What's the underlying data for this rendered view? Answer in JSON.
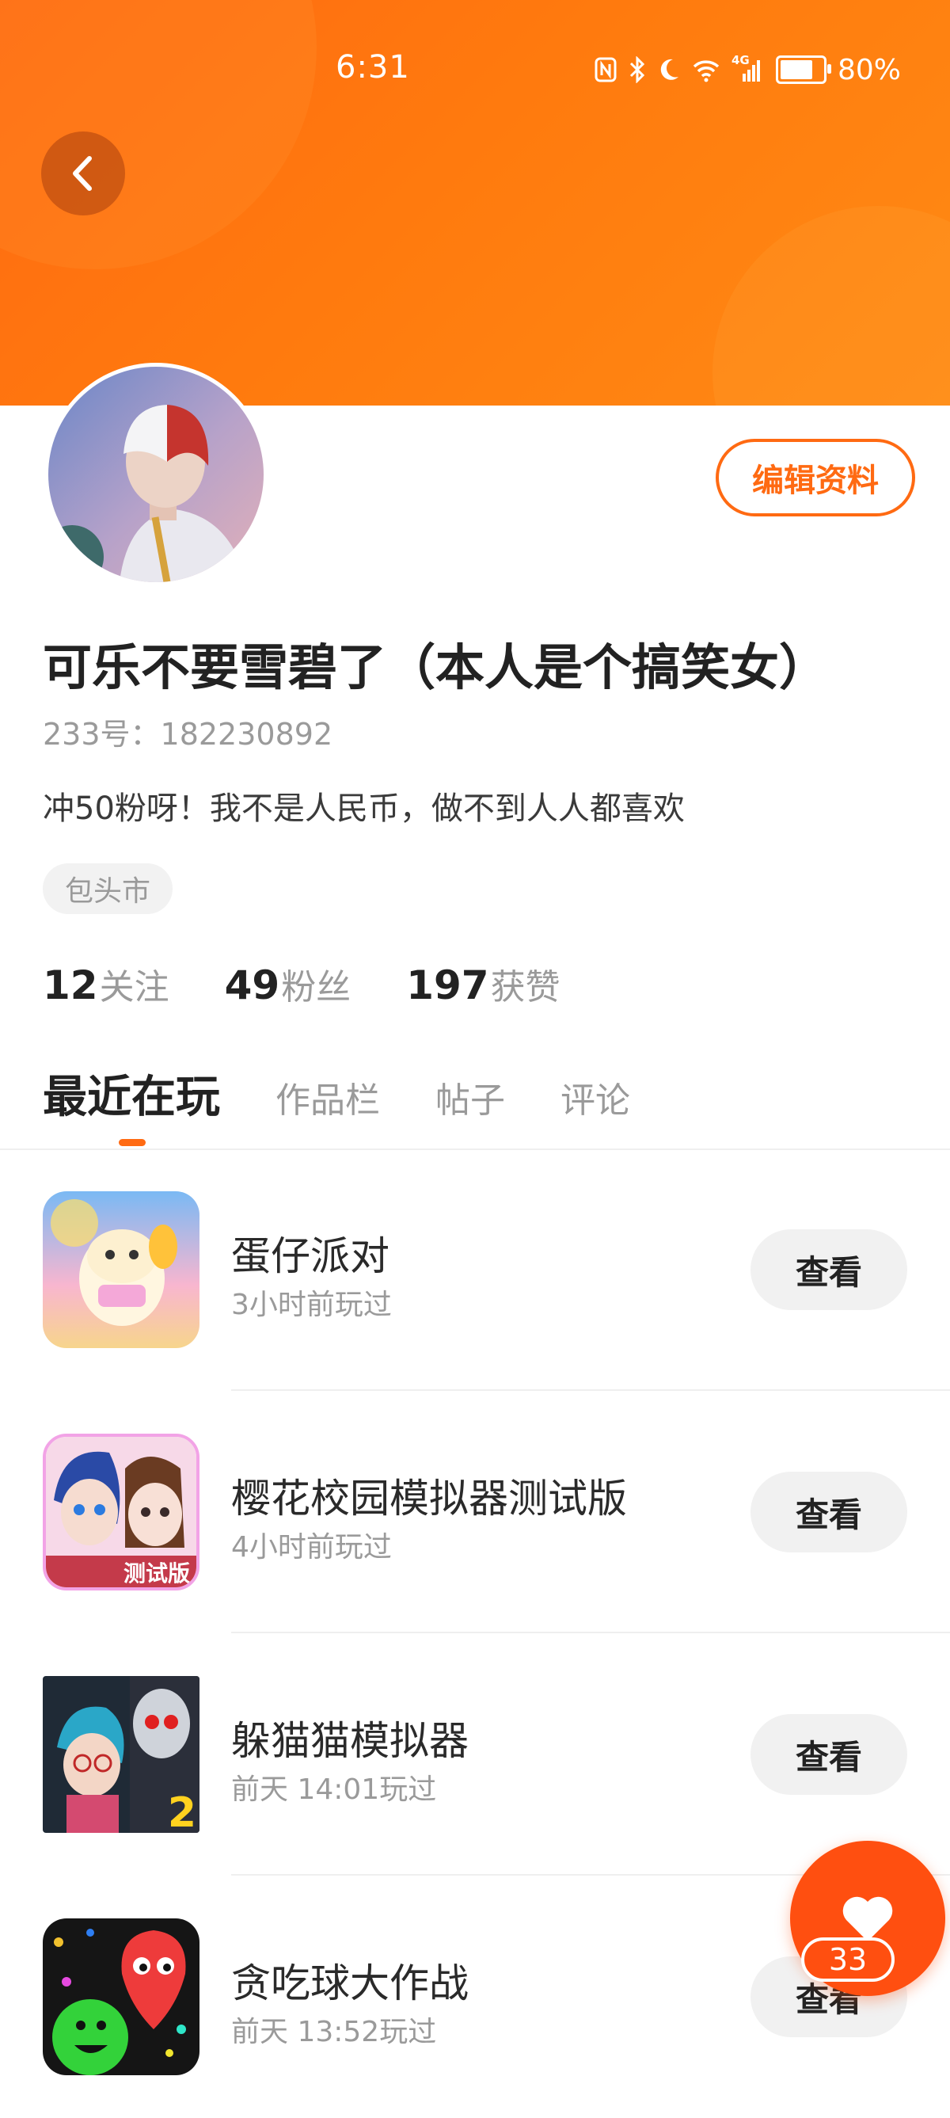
{
  "status_bar": {
    "time": "6:31",
    "network": "4G",
    "battery": "80%"
  },
  "profile": {
    "edit_label": "编辑资料",
    "nickname": "可乐不要雪碧了（本人是个搞笑女）",
    "uid": "233号：182230892",
    "bio": "冲50粉呀！我不是人民币，做不到人人都喜欢",
    "location": "包头市",
    "stats": [
      {
        "num": "12",
        "label": "关注"
      },
      {
        "num": "49",
        "label": "粉丝"
      },
      {
        "num": "197",
        "label": "获赞"
      }
    ]
  },
  "tabs": [
    "最近在玩",
    "作品栏",
    "帖子",
    "评论"
  ],
  "active_tab": "最近在玩",
  "games": [
    {
      "name": "蛋仔派对",
      "time": "3小时前玩过",
      "button": "查看"
    },
    {
      "name": "樱花校园模拟器测试版",
      "time": "4小时前玩过",
      "button": "查看"
    },
    {
      "name": "躲猫猫模拟器",
      "time": "前天 14:01玩过",
      "button": "查看"
    },
    {
      "name": "贪吃球大作战",
      "time": "前天 13:52玩过",
      "button": "查看"
    }
  ],
  "game_icon_texts": [
    "测试版",
    "2"
  ],
  "fab": {
    "count": "33"
  },
  "colors": {
    "accent": "#ff6a12",
    "fab": "#ff4f10"
  }
}
